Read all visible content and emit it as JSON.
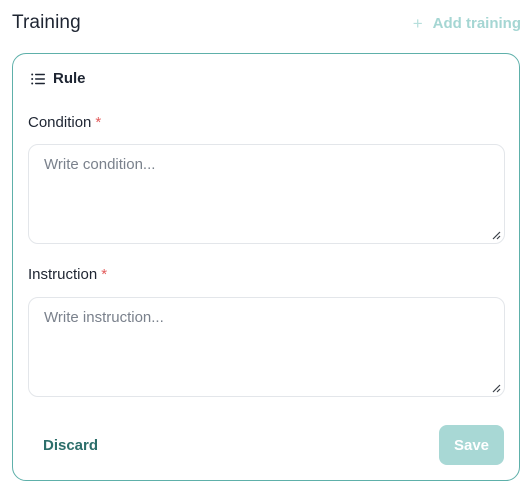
{
  "header": {
    "title": "Training",
    "add_button_label": "Add training",
    "add_icon": "+"
  },
  "rule": {
    "heading": "Rule",
    "icon": "list-icon"
  },
  "fields": {
    "condition": {
      "label": "Condition",
      "required_mark": "*",
      "placeholder": "Write condition...",
      "value": ""
    },
    "instruction": {
      "label": "Instruction",
      "required_mark": "*",
      "placeholder": "Write instruction...",
      "value": ""
    }
  },
  "actions": {
    "discard_label": "Discard",
    "save_label": "Save"
  },
  "colors": {
    "accent": "#5eb0aa",
    "accent_disabled": "#a8d8d5",
    "required": "#e25b5b",
    "discard_text": "#2d6f6b"
  }
}
